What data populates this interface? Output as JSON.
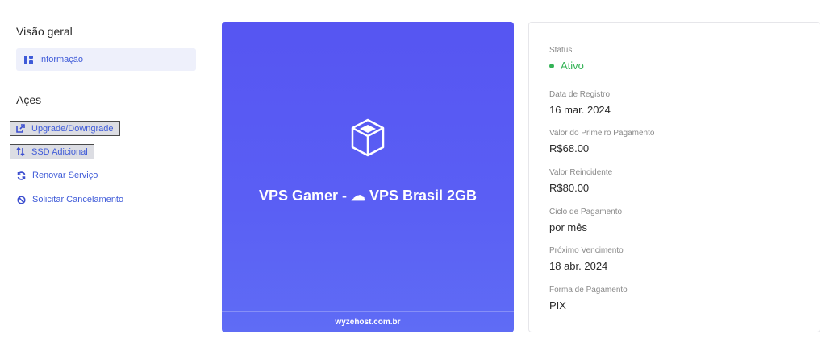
{
  "sidebar": {
    "overview_title": "Visão geral",
    "info_label": "Informação",
    "actions_title": "Açes",
    "actions": [
      {
        "label": "Upgrade/Downgrade",
        "icon": "external-link-icon"
      },
      {
        "label": "SSD Adicional",
        "icon": "swap-arrows-icon"
      },
      {
        "label": "Renovar Serviço",
        "icon": "sync-icon"
      },
      {
        "label": "Solicitar Cancelamento",
        "icon": "ban-icon"
      }
    ]
  },
  "product": {
    "name": "VPS Gamer - ☁ VPS Brasil 2GB",
    "footer": "wyzehost.com.br",
    "icon": "cube-icon",
    "color": "#5655f2"
  },
  "details": {
    "status_label": "Status",
    "status_value": "Ativo",
    "status_color": "#34b356",
    "reg_label": "Data de Registro",
    "reg_value": "16 mar. 2024",
    "first_label": "Valor do Primeiro Pagamento",
    "first_value": "R$68.00",
    "recur_label": "Valor Reincidente",
    "recur_value": "R$80.00",
    "cycle_label": "Ciclo de Pagamento",
    "cycle_value": "por mês",
    "next_label": "Próximo Vencimento",
    "next_value": "18 abr. 2024",
    "method_label": "Forma de Pagamento",
    "method_value": "PIX"
  }
}
